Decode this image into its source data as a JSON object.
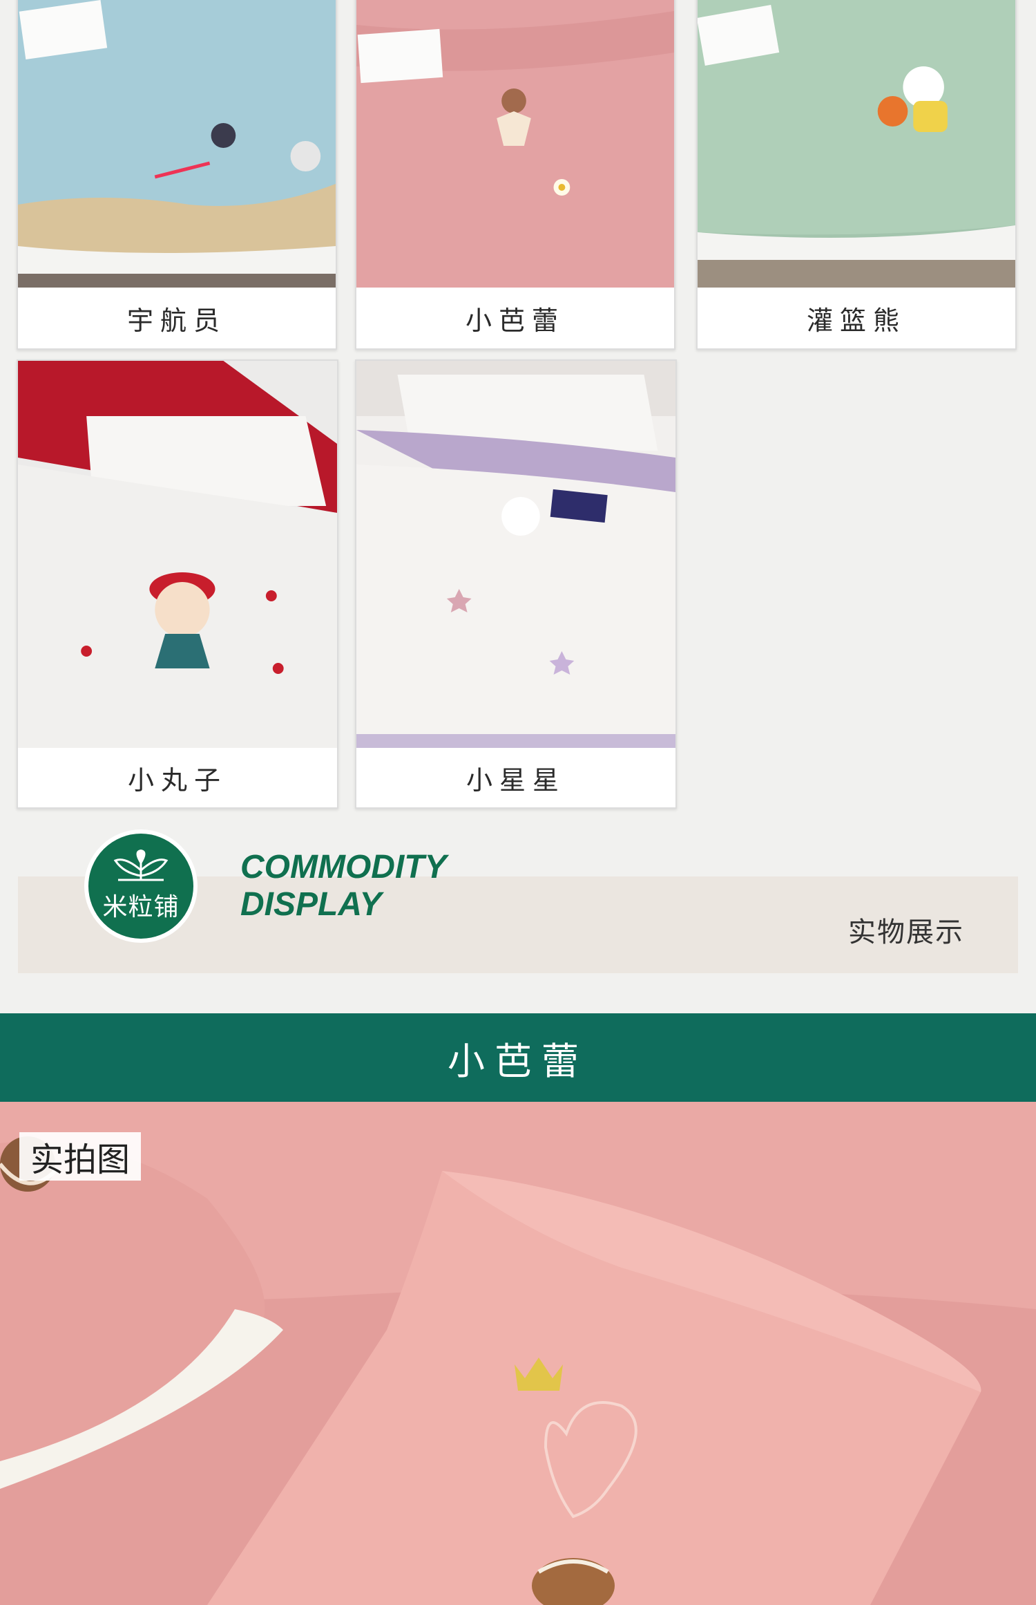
{
  "products": [
    {
      "name": "宇航员",
      "image": "astronaut-bedding-photo",
      "color": "#9ec3ce"
    },
    {
      "name": "小芭蕾",
      "image": "ballet-bedding-photo",
      "color": "#e3a0a1"
    },
    {
      "name": "灌篮熊",
      "image": "dunk-bear-bedding-photo",
      "color": "#a9c8b1"
    },
    {
      "name": "小丸子",
      "image": "maruko-bedding-photo",
      "color": "#eeecea"
    },
    {
      "name": "小星星",
      "image": "little-star-bedding-photo",
      "color": "#f1efee"
    }
  ],
  "banner": {
    "brand": "米粒铺",
    "title_line1": "COMMODITY",
    "title_line2": "DISPLAY",
    "subtitle": "实物展示"
  },
  "section": {
    "title": "小芭蕾",
    "tag": "实拍图",
    "accent": "#0f6c5c"
  }
}
